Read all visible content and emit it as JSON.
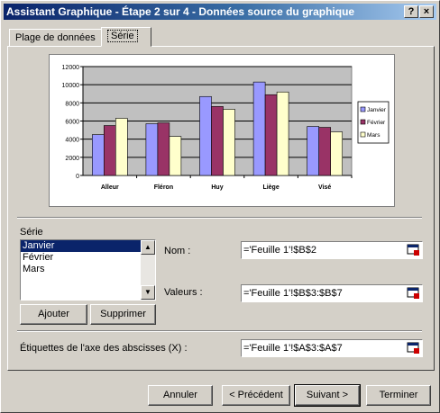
{
  "window": {
    "title": "Assistant Graphique - Étape 2 sur 4 - Données source du graphique",
    "help_button": "?",
    "close_button": "×"
  },
  "tabs": [
    {
      "label": "Plage de données",
      "active": false
    },
    {
      "label": "Série",
      "active": true
    }
  ],
  "chart_data": {
    "type": "bar",
    "categories": [
      "Alleur",
      "Fléron",
      "Huy",
      "Liège",
      "Visé"
    ],
    "series": [
      {
        "name": "Janvier",
        "color": "#9999ff",
        "values": [
          4500,
          5700,
          8700,
          10300,
          5400
        ]
      },
      {
        "name": "Février",
        "color": "#993366",
        "values": [
          5500,
          5800,
          7600,
          8900,
          5300
        ]
      },
      {
        "name": "Mars",
        "color": "#ffffcc",
        "values": [
          6300,
          4300,
          7300,
          9200,
          4800
        ]
      }
    ],
    "ylim": [
      0,
      12000
    ],
    "yticks": [
      "12000",
      "10000",
      "8000",
      "6000",
      "4000",
      "2000",
      "0"
    ],
    "grid": true,
    "plot_background": "#c0c0c0",
    "legend_position": "right"
  },
  "series_section": {
    "label": "Série",
    "items": [
      "Janvier",
      "Février",
      "Mars"
    ],
    "selected": "Janvier",
    "add_button": "Ajouter",
    "remove_button": "Supprimer"
  },
  "fields": {
    "name_label": "Nom :",
    "name_value": "='Feuille 1'!$B$2",
    "values_label": "Valeurs :",
    "values_value": "='Feuille 1'!$B$3:$B$7",
    "xaxis_label": "Étiquettes de l'axe des abscisses (X) :",
    "xaxis_value": "='Feuille 1'!$A$3:$A$7"
  },
  "footer": {
    "cancel": "Annuler",
    "previous": "< Précédent",
    "next": "Suivant >",
    "finish": "Terminer"
  }
}
